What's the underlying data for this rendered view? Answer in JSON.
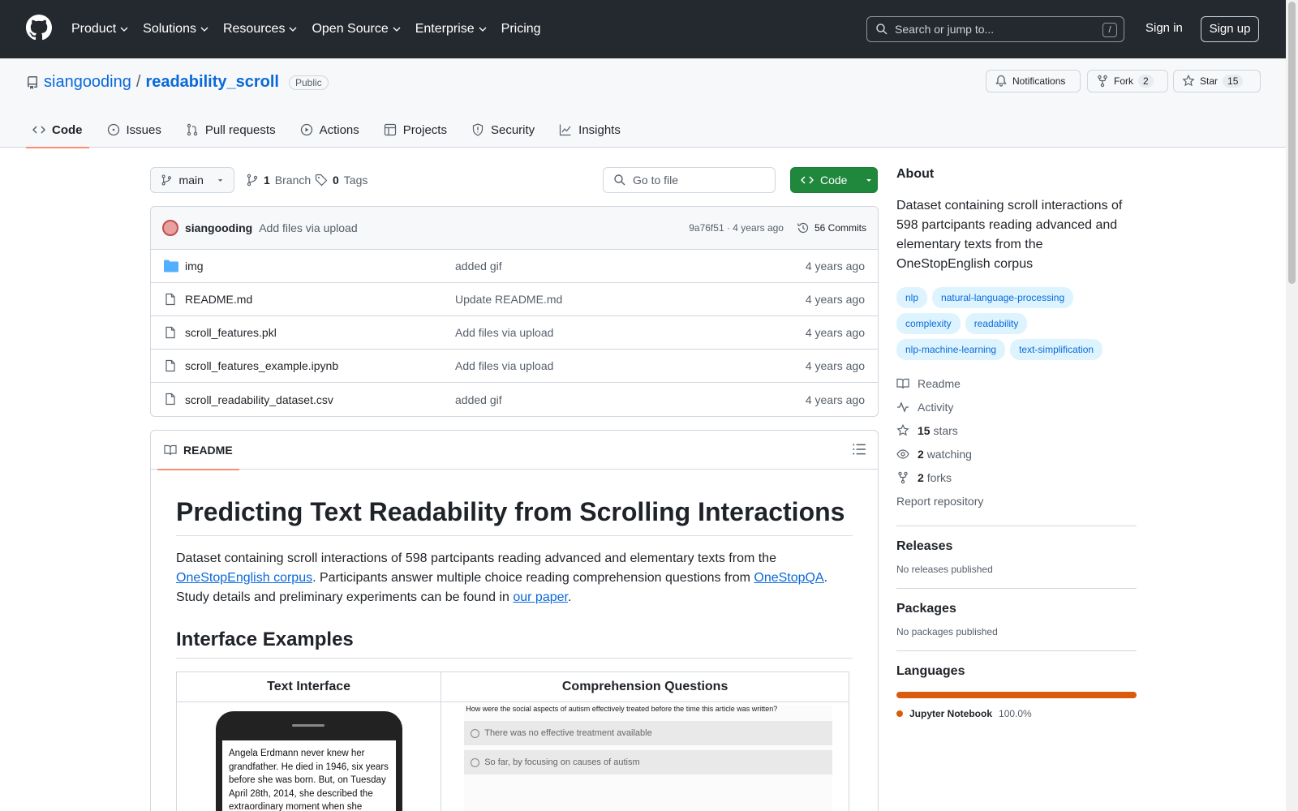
{
  "header": {
    "nav": [
      "Product",
      "Solutions",
      "Resources",
      "Open Source",
      "Enterprise",
      "Pricing"
    ],
    "search_placeholder": "Search or jump to...",
    "search_kbd": "/",
    "sign_in": "Sign in",
    "sign_up": "Sign up"
  },
  "repo": {
    "owner": "siangooding",
    "separator": "/",
    "name": "readability_scroll",
    "visibility": "Public",
    "notifications_label": "Notifications",
    "fork_label": "Fork",
    "fork_count": "2",
    "star_label": "Star",
    "star_count": "15",
    "tabs": [
      "Code",
      "Issues",
      "Pull requests",
      "Actions",
      "Projects",
      "Security",
      "Insights"
    ]
  },
  "branchbar": {
    "branch": "main",
    "branch_count": "1",
    "branch_label": "Branch",
    "tag_count": "0",
    "tag_label": "Tags",
    "goto_file_placeholder": "Go to file",
    "code_button": "Code"
  },
  "latest_commit": {
    "author": "siangooding",
    "message": "Add files via upload",
    "hash_age": "9a76f51 · 4 years ago",
    "commits": "56 Commits"
  },
  "files": [
    {
      "name": "img",
      "type": "folder",
      "message": "added gif",
      "age": "4 years ago"
    },
    {
      "name": "README.md",
      "type": "file",
      "message": "Update README.md",
      "age": "4 years ago"
    },
    {
      "name": "scroll_features.pkl",
      "type": "file",
      "message": "Add files via upload",
      "age": "4 years ago"
    },
    {
      "name": "scroll_features_example.ipynb",
      "type": "file",
      "message": "Add files via upload",
      "age": "4 years ago"
    },
    {
      "name": "scroll_readability_dataset.csv",
      "type": "file",
      "message": "added gif",
      "age": "4 years ago"
    }
  ],
  "readme": {
    "tab": "README",
    "title": "Predicting Text Readability from Scrolling Interactions",
    "p1_a": "Dataset containing scroll interactions of 598 partcipants reading advanced and elementary texts from the ",
    "p1_link1": "OneStopEnglish corpus",
    "p1_b": ". Participants answer multiple choice reading comprehension questions from ",
    "p1_link2": "OneStopQA",
    "p1_c": ". Study details and preliminary experiments can be found in ",
    "p1_link3": "our paper",
    "p1_d": ".",
    "h2": "Interface Examples",
    "col1": "Text Interface",
    "col2": "Comprehension Questions",
    "phone_text": "Angela Erdmann never knew her grandfather. He died in 1946, six years before she was born. But, on Tuesday April 28th, 2014, she described the extraordinary moment when she received",
    "question": "How were the social aspects of autism effectively treated before the time this article was written?",
    "option1": "There was no effective treatment available",
    "option2": "So far, by focusing on causes of autism"
  },
  "about": {
    "title": "About",
    "description": "Dataset containing scroll interactions of 598 partcipants reading advanced and elementary texts from the OneStopEnglish corpus",
    "topics": [
      "nlp",
      "natural-language-processing",
      "complexity",
      "readability",
      "nlp-machine-learning",
      "text-simplification"
    ],
    "readme": "Readme",
    "activity": "Activity",
    "stars_count": "15",
    "stars_label": "stars",
    "watching_count": "2",
    "watching_label": "watching",
    "forks_count": "2",
    "forks_label": "forks",
    "report": "Report repository"
  },
  "releases": {
    "title": "Releases",
    "none": "No releases published"
  },
  "packages": {
    "title": "Packages",
    "none": "No packages published"
  },
  "languages": {
    "title": "Languages",
    "items": [
      {
        "name": "Jupyter Notebook",
        "percent": "100.0%",
        "fraction": 1.0,
        "color": "#DA5B0B"
      }
    ]
  }
}
